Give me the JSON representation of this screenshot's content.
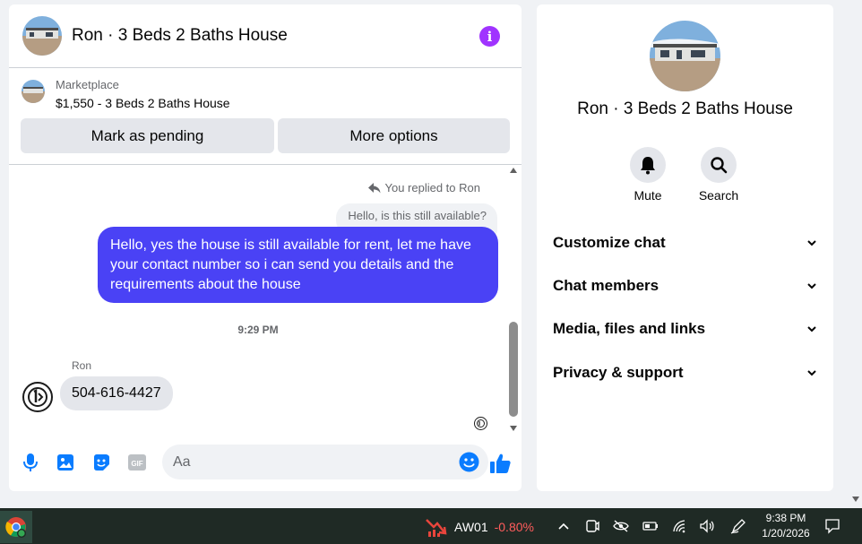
{
  "chat": {
    "title": "Ron · 3 Beds 2 Baths House",
    "info_icon": "info-icon",
    "listing": {
      "source": "Marketplace",
      "price_title": "$1,550 - 3 Beds 2 Baths House",
      "mark_pending_label": "Mark as pending",
      "more_options_label": "More options"
    },
    "messages": {
      "replied_note": "You replied to Ron",
      "quoted_text": "Hello, is this still available?",
      "sent_text": "Hello, yes the house is still available for rent, let me have your contact number so i can send you details and the requirements about the house",
      "timestamp": "9:29 PM",
      "sender_name": "Ron",
      "received_text": "504-616-4427"
    },
    "composer": {
      "placeholder": "Aa",
      "icons": [
        "microphone-icon",
        "image-icon",
        "sticker-icon",
        "gif-icon",
        "emoji-icon",
        "thumbs-up-icon"
      ],
      "gif_label": "GIF"
    }
  },
  "info_panel": {
    "title": "Ron · 3 Beds 2 Baths House",
    "mute_label": "Mute",
    "search_label": "Search",
    "sections": [
      {
        "label": "Customize chat"
      },
      {
        "label": "Chat members"
      },
      {
        "label": "Media, files and links"
      },
      {
        "label": "Privacy & support"
      }
    ]
  },
  "taskbar": {
    "stock_symbol": "AW01",
    "stock_change": "-0.80%",
    "time": "9:38 PM",
    "date": "1/20/2026"
  },
  "colors": {
    "accent": "#4a42f5",
    "info": "#a033ff",
    "icon_blue": "#0a7cff",
    "stock_down": "#ff5c5c"
  }
}
